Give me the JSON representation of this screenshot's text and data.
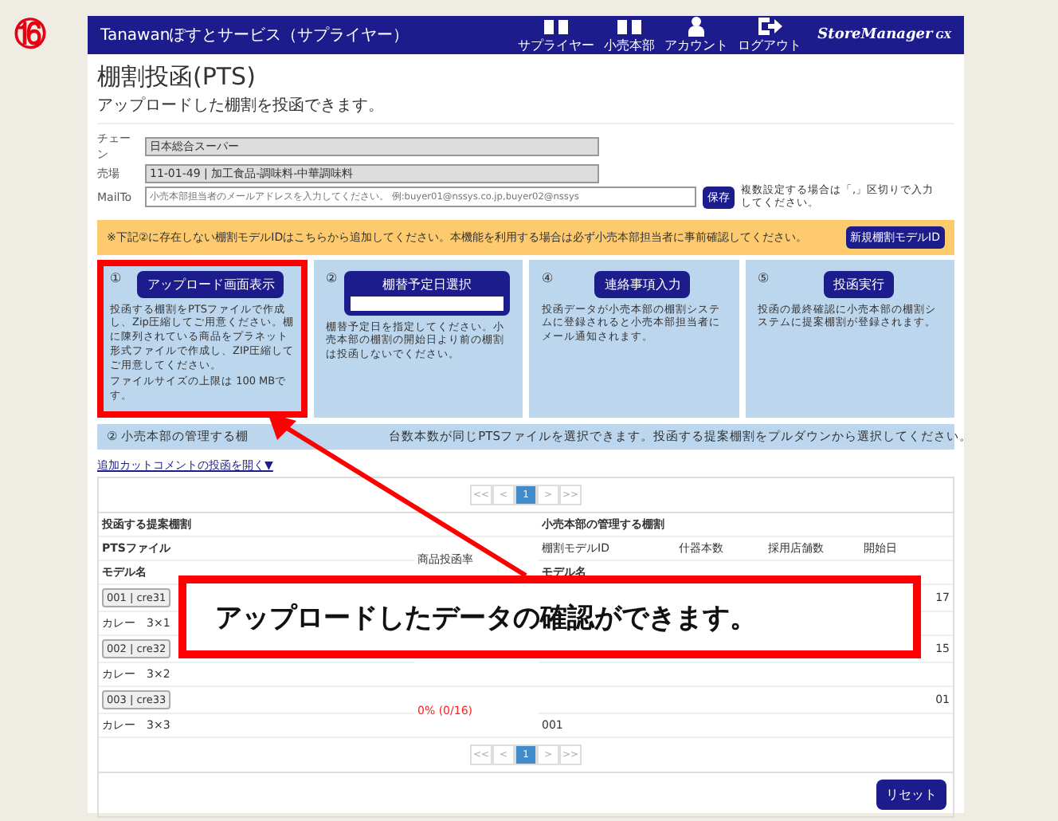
{
  "step_badge": "⑯",
  "header": {
    "title": "Tanawanぽすとサービス（サプライヤー）",
    "icons": [
      {
        "kind": "book",
        "label": "サプライヤー"
      },
      {
        "kind": "book",
        "label": "小売本部"
      },
      {
        "kind": "person",
        "label": "アカウント"
      },
      {
        "kind": "logout",
        "label": "ログアウト"
      }
    ],
    "logo": "StoreManager",
    "logo_sub": "GX"
  },
  "page": {
    "title": "棚割投函(PTS)",
    "subtitle": "アップロードした棚割を投函できます。"
  },
  "fields": [
    {
      "label": "チェーン",
      "value": "日本総合スーパー",
      "kind": "readonly"
    },
    {
      "label": "売場",
      "value": "11-01-49 | 加工食品-調味料-中華調味料",
      "kind": "readonly"
    },
    {
      "label": "MailTo",
      "placeholder": "小売本部担当者のメールアドレスを入力してください。 例:buyer01@nssys.co.jp,buyer02@nssys",
      "kind": "input",
      "button": "保存",
      "note": "複数設定する場合は「,」区切りで入力してください。"
    }
  ],
  "notice": {
    "text": "※下記②に存在しない棚割モデルIDはこちらから追加してください。本機能を利用する場合は必ず小売本部担当者に事前確認してください。",
    "button": "新規棚割モデルID"
  },
  "steps": [
    {
      "number": "①",
      "button": "アップロード画面表示",
      "kind": "button",
      "highlighted": true,
      "texts": [
        "投函する棚割をPTSファイルで作成し、Zip圧縮してご用意ください。棚に陳列されている商品をプラネット形式ファイルで作成し、ZIP圧縮してご用意してください。",
        "ファイルサイズの上限は 100 MBです。"
      ]
    },
    {
      "number": "②",
      "button": "棚替予定日選択",
      "kind": "date",
      "highlighted": false,
      "texts": [
        "棚替予定日を指定してください。小売本部の棚割の開始日より前の棚割は投函しないでください。"
      ]
    },
    {
      "number": "④",
      "button": "連絡事項入力",
      "kind": "button",
      "highlighted": false,
      "texts": [
        "投函データが小売本部の棚割システムに登録されると小売本部担当者にメール通知されます。"
      ]
    },
    {
      "number": "⑤",
      "button": "投函実行",
      "kind": "button",
      "highlighted": false,
      "texts": [
        "投函の最終確認に小売本部の棚割システムに提案棚割が登録されます。"
      ]
    }
  ],
  "info_bar": {
    "number": "②",
    "text_left": "小売本部の管理する棚",
    "text_right": "台数本数が同じPTSファイルを選択できます。投函する提案棚割をプルダウンから選択してください。"
  },
  "comment_link": "追加カットコメントの投函を開く▼",
  "pager_top": [
    {
      "label": "<<",
      "selected": false
    },
    {
      "label": "<",
      "selected": false
    },
    {
      "label": "1",
      "selected": true
    },
    {
      "label": ">",
      "selected": false
    },
    {
      "label": ">>",
      "selected": false
    }
  ],
  "pager_bottom": [
    {
      "label": "<<",
      "selected": false
    },
    {
      "label": "<",
      "selected": false
    },
    {
      "label": "1",
      "selected": true
    },
    {
      "label": ">",
      "selected": false
    },
    {
      "label": ">>",
      "selected": false
    }
  ],
  "table": {
    "left_group": "投函する提案棚割",
    "right_group": "小売本部の管理する棚割",
    "left_columns": [
      "PTSファイル",
      "モデル名"
    ],
    "rate_column": "商品投函率",
    "right_columns": [
      "棚割モデルID",
      "什器本数",
      "採用店舗数",
      "開始日"
    ],
    "right_sub": "モデル名",
    "rows": [
      {
        "file": "001 | cre31",
        "name": "カレー　3×1",
        "end": "17"
      },
      {
        "file": "002 | cre32",
        "name": "カレー　3×2",
        "end": "15"
      },
      {
        "file": "003 | cre33",
        "name": "カレー　3×3",
        "rate": "0% (0/16)",
        "end": "01",
        "model_name": "001"
      }
    ]
  },
  "reset_button": "リセット",
  "callout": {
    "text": "アップロードしたデータの確認ができます。"
  }
}
